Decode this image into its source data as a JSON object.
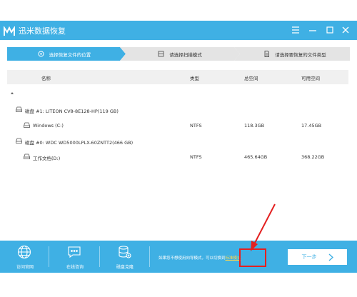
{
  "window": {
    "title": "迅米数据恢复",
    "menu_icon": "menu-icon",
    "min_icon": "minimize-icon",
    "max_icon": "maximize-icon",
    "close_icon": "close-icon"
  },
  "steps": [
    {
      "label": "选择恢复文件的位置",
      "icon": "location-icon",
      "active": true
    },
    {
      "label": "请选择扫描模式",
      "icon": "scan-mode-icon",
      "active": false
    },
    {
      "label": "请选择要恢复的文件类型",
      "icon": "file-type-icon",
      "active": false
    }
  ],
  "table": {
    "headers": {
      "name": "名称",
      "type": "类型",
      "total": "总空间",
      "free": "可用空间"
    },
    "rows": [
      {
        "kind": "disk",
        "name": "磁盘 #1: LITEON CV8-8E128-HP(119 GB)"
      },
      {
        "kind": "partition",
        "name": "Windows (C:)",
        "type": "NTFS",
        "total": "118.3GB",
        "free": "17.45GB"
      },
      {
        "kind": "disk",
        "name": "磁盘 #0: WDC WD5000LPLX-60ZNTT2(466 GB)"
      },
      {
        "kind": "partition",
        "name": "工作文档(D:)",
        "type": "NTFS",
        "total": "465.64GB",
        "free": "368.22GB"
      }
    ]
  },
  "footer": {
    "buttons": [
      {
        "label": "访问官网",
        "icon": "globe-icon"
      },
      {
        "label": "在线咨询",
        "icon": "chat-icon"
      },
      {
        "label": "磁盘克隆",
        "icon": "disk-clone-icon"
      }
    ],
    "hint_text": "如果您不想使用向导模式，可以切换到",
    "hint_link": "标准模式",
    "next_label": "下一步"
  },
  "colors": {
    "accent": "#3fb0e4",
    "active_step": "#3fb0e4",
    "inactive_step": "#e4e4e4",
    "highlight": "#e32020"
  }
}
